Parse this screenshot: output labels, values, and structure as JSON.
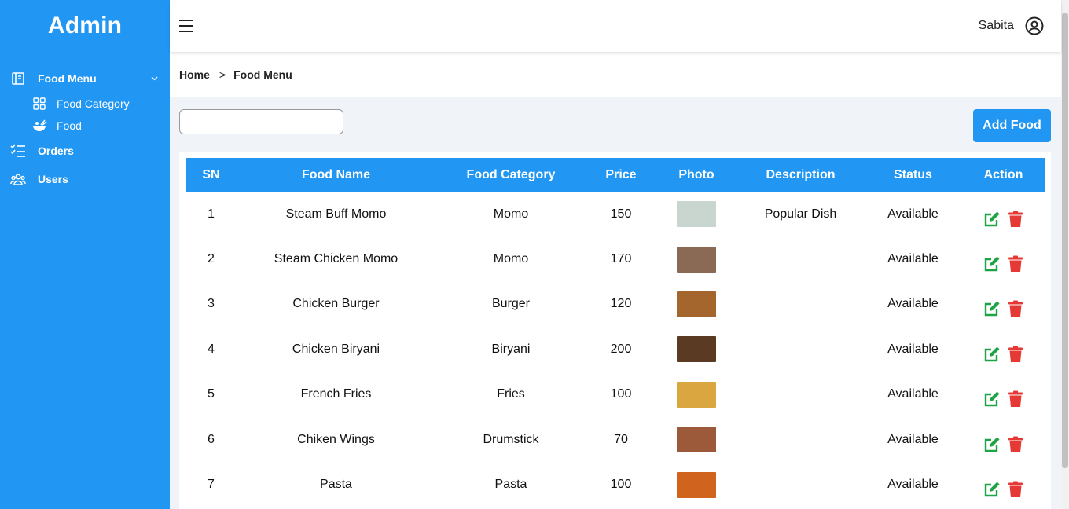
{
  "app": {
    "brand": "Admin"
  },
  "sidebar": {
    "items": [
      {
        "label": "Food Menu",
        "icon": "book-icon"
      },
      {
        "label": "Orders",
        "icon": "checklist-icon"
      },
      {
        "label": "Users",
        "icon": "users-icon"
      }
    ],
    "subitems": [
      {
        "label": "Food Category",
        "icon": "grid-icon"
      },
      {
        "label": "Food",
        "icon": "food-bowl-icon"
      }
    ]
  },
  "topbar": {
    "user_name": "Sabita"
  },
  "breadcrumb": {
    "home": "Home",
    "separator": ">",
    "current": "Food Menu"
  },
  "search": {
    "placeholder": "",
    "value": ""
  },
  "toolbar": {
    "add_label": "Add Food"
  },
  "table": {
    "headers": [
      "SN",
      "Food Name",
      "Food Category",
      "Price",
      "Photo",
      "Description",
      "Status",
      "Action"
    ],
    "rows": [
      {
        "sn": "1",
        "name": "Steam Buff Momo",
        "category": "Momo",
        "price": "150",
        "description": "Popular Dish",
        "status": "Available",
        "photo_color": "#c9d6cf"
      },
      {
        "sn": "2",
        "name": "Steam Chicken Momo",
        "category": "Momo",
        "price": "170",
        "description": "",
        "status": "Available",
        "photo_color": "#8a6a55"
      },
      {
        "sn": "3",
        "name": "Chicken Burger",
        "category": "Burger",
        "price": "120",
        "description": "",
        "status": "Available",
        "photo_color": "#a5662e"
      },
      {
        "sn": "4",
        "name": "Chicken Biryani",
        "category": "Biryani",
        "price": "200",
        "description": "",
        "status": "Available",
        "photo_color": "#5b3a24"
      },
      {
        "sn": "5",
        "name": "French Fries",
        "category": "Fries",
        "price": "100",
        "description": "",
        "status": "Available",
        "photo_color": "#d9a640"
      },
      {
        "sn": "6",
        "name": "Chiken Wings",
        "category": "Drumstick",
        "price": "70",
        "description": "",
        "status": "Available",
        "photo_color": "#9c5a3a"
      },
      {
        "sn": "7",
        "name": "Pasta",
        "category": "Pasta",
        "price": "100",
        "description": "",
        "status": "Available",
        "photo_color": "#d0641f"
      }
    ]
  },
  "colors": {
    "primary": "#2196f3",
    "edit": "#1ea345",
    "delete": "#e53935"
  }
}
